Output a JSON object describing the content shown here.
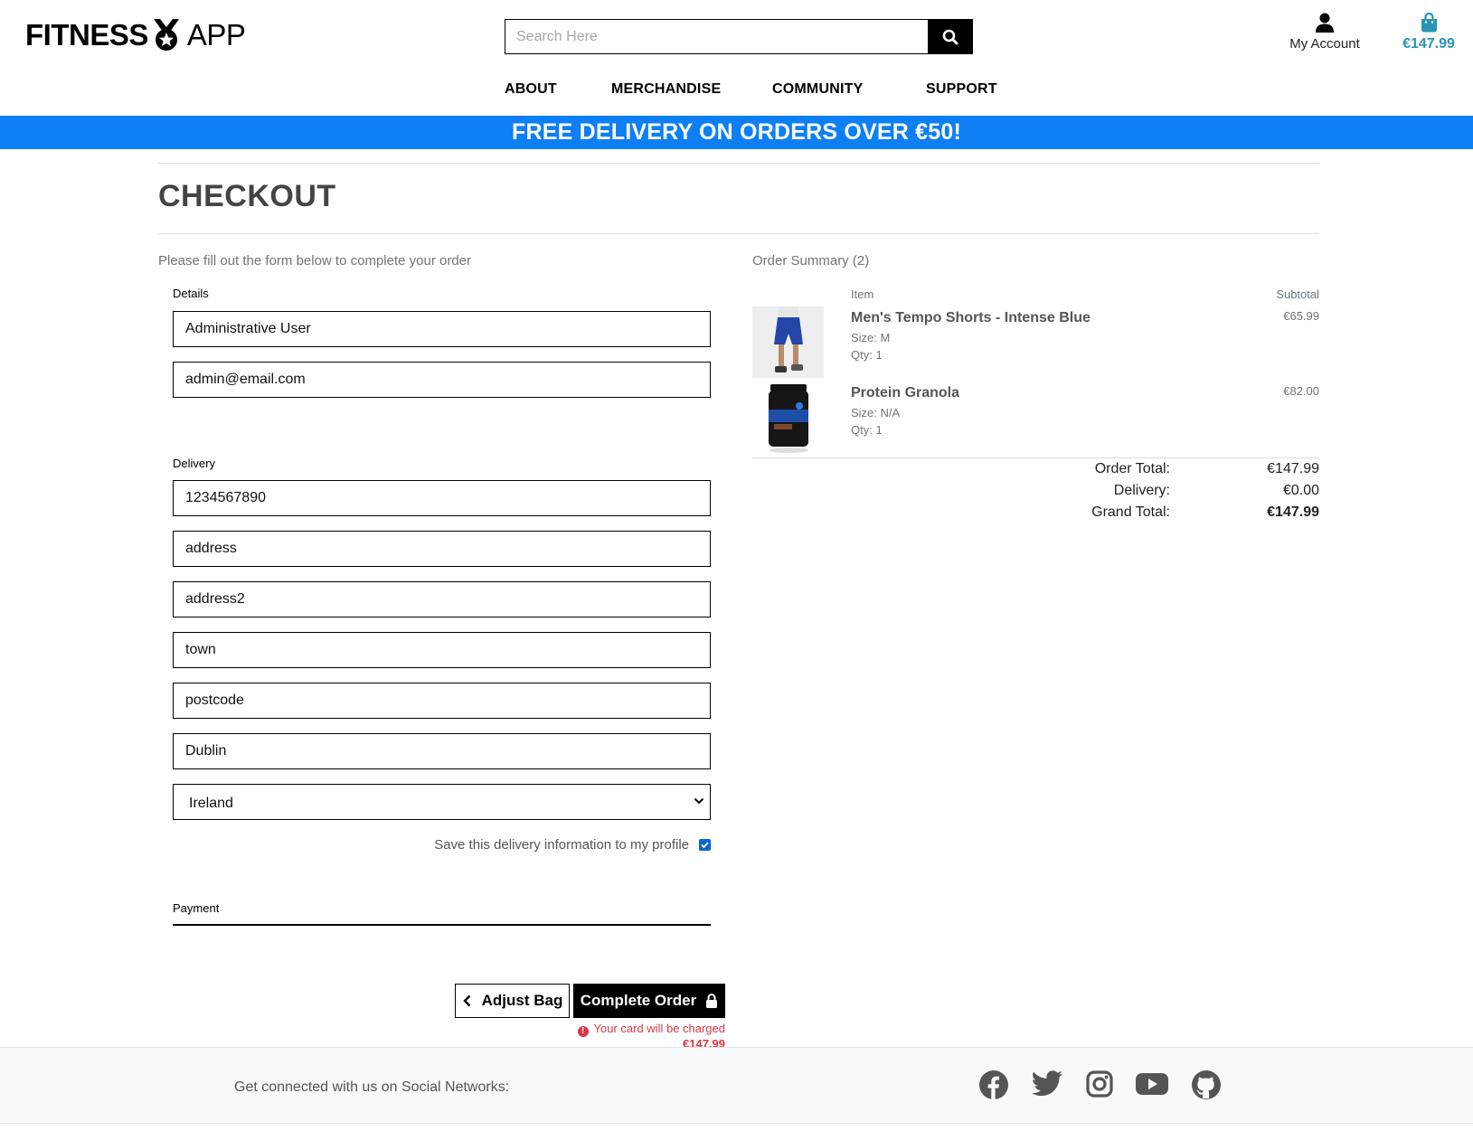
{
  "brand": {
    "name_bold": "FITNESS",
    "name_light": "APP"
  },
  "search": {
    "placeholder": "Search Here"
  },
  "account": {
    "label": "My Account"
  },
  "bag": {
    "total": "€147.99",
    "accent": "#2a94b8"
  },
  "nav": {
    "items": [
      "ABOUT",
      "MERCHANDISE",
      "COMMUNITY",
      "SUPPORT"
    ]
  },
  "banner": {
    "text": "FREE DELIVERY ON ORDERS OVER €50!",
    "color": "#0d7ff5"
  },
  "checkout": {
    "title": "CHECKOUT",
    "intro": "Please fill out the form below to complete your order",
    "details_label": "Details",
    "full_name": "Administrative User",
    "email": "admin@email.com",
    "delivery_label": "Delivery",
    "phone": "1234567890",
    "address1": "address",
    "address2": "address2",
    "town": "town",
    "postcode": "postcode",
    "county": "Dublin",
    "country": "Ireland",
    "save_info": "Save this delivery information to my profile",
    "save_checked": true,
    "payment_label": "Payment",
    "adjust_bag": "Adjust Bag",
    "complete_order": "Complete Order",
    "charge_text": "Your card will be charged",
    "charge_amount": "€147.99",
    "error_color": "#dc3545"
  },
  "summary": {
    "title": "Order Summary (2)",
    "col_item": "Item",
    "col_subtotal": "Subtotal",
    "items": [
      {
        "name": "Men's Tempo Shorts - Intense Blue",
        "size": "Size: M",
        "qty": "Qty: 1",
        "subtotal": "€65.99"
      },
      {
        "name": "Protein Granola",
        "size": "Size: N/A",
        "qty": "Qty: 1",
        "subtotal": "€82.00"
      }
    ],
    "order_total_label": "Order Total:",
    "order_total": "€147.99",
    "delivery_label": "Delivery:",
    "delivery": "€0.00",
    "grand_total_label": "Grand Total:",
    "grand_total": "€147.99"
  },
  "footer": {
    "text": "Get connected with us on Social Networks:",
    "icons": [
      "facebook-icon",
      "twitter-icon",
      "instagram-icon",
      "youtube-icon",
      "github-icon"
    ]
  }
}
